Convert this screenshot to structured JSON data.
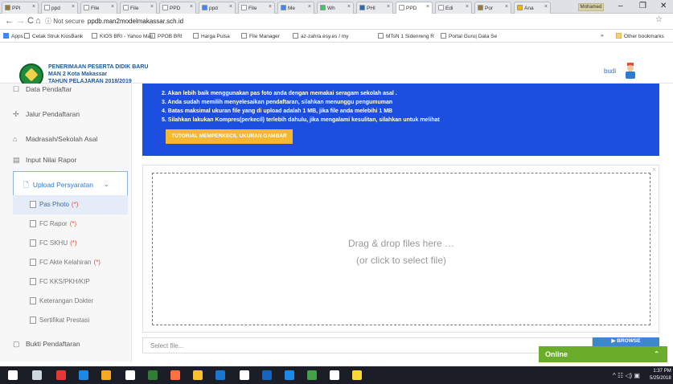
{
  "browser": {
    "tabs": [
      {
        "label": "PPI",
        "fav": "#9c7b2d",
        "active": false
      },
      {
        "label": "ppd",
        "fav": "#ffffff",
        "active": false
      },
      {
        "label": "File",
        "fav": "#ffffff",
        "active": false
      },
      {
        "label": "File",
        "fav": "#ffffff",
        "active": false
      },
      {
        "label": "PPD",
        "fav": "#ffffff",
        "active": false
      },
      {
        "label": "ppd",
        "fav": "#4285f4",
        "active": false
      },
      {
        "label": "File",
        "fav": "#ffffff",
        "active": false
      },
      {
        "label": "Me",
        "fav": "#4285f4",
        "active": false
      },
      {
        "label": "Wh",
        "fav": "#25d366",
        "active": false
      },
      {
        "label": "PHI",
        "fav": "#2b6bb0",
        "active": false
      },
      {
        "label": "PPD",
        "fav": "#ffffff",
        "active": true
      },
      {
        "label": "Edi",
        "fav": "#ffffff",
        "active": false
      },
      {
        "label": "Por",
        "fav": "#9c7b2d",
        "active": false
      },
      {
        "label": "Ana",
        "fav": "#f4b400",
        "active": false
      }
    ],
    "tab_close": "×",
    "profile_name": "Mohamed",
    "window_controls": {
      "minimize": "–",
      "maximize": "❐",
      "close": "✕"
    },
    "nav": {
      "back": "←",
      "forward": "→",
      "reload": "C",
      "home": "⌂"
    },
    "url_security": "ⓘ Not secure",
    "url": "ppdb.man2modelmakassar.sch.id",
    "star": "☆",
    "bookmarks": [
      {
        "label": "Apps"
      },
      {
        "label": "Cetak Struk KiosBank"
      },
      {
        "label": "KIOS BRI - Yahoo Mail"
      },
      {
        "label": "PPOB BRI"
      },
      {
        "label": "Harga Pulsa"
      },
      {
        "label": "File Manager"
      },
      {
        "label": "az-zahra.esy.es / my"
      },
      {
        "label": "MTsN 1 Sidenreng R"
      },
      {
        "label": "Portal Guru| Data Se"
      }
    ],
    "bookmarks_more": "»",
    "other_bookmarks": "Other bookmarks"
  },
  "header": {
    "title_line1": "PENERIMAAN PESERTA DIDIK BARU",
    "title_line2": "MAN 2 Kota Makassar",
    "title_line3": "TAHUN PELAJARAN 2018/2019",
    "user": "budi"
  },
  "sidebar": {
    "items": [
      {
        "label": "Data Pendaftar",
        "icon": "user-icon"
      },
      {
        "label": "Jalur Pendaftaran",
        "icon": "route-icon"
      },
      {
        "label": "Madrasah/Sekolah Asal",
        "icon": "graduation-cap-icon"
      },
      {
        "label": "Input Nilai Rapor",
        "icon": "book-icon"
      }
    ],
    "upload": {
      "label": "Upload Persyaratan",
      "icon": "file-icon",
      "chevron": "⌄"
    },
    "sub_items": [
      {
        "label": "Pas Photo",
        "required": "(*)"
      },
      {
        "label": "FC Rapor",
        "required": "(*)"
      },
      {
        "label": "FC SKHU",
        "required": "(*)"
      },
      {
        "label": "FC Akte Kelahiran",
        "required": "(*)"
      },
      {
        "label": "FC KKS/PKH/KIP",
        "required": ""
      },
      {
        "label": "Keterangan Dokter",
        "required": ""
      },
      {
        "label": "Sertifikat Prestasi",
        "required": ""
      }
    ],
    "bukti": {
      "label": "Bukti Pendaftaran"
    }
  },
  "info": {
    "lines": [
      "2. Akan lebih baik menggunakan pas foto anda dengan memakai seragam sekolah asal .",
      "3. Anda sudah memilih menyelesaikan pendaftaran, silahkan menunggu pengumuman",
      "4. Batas maksimal ukuran file yang di upload adalah 1 MB, jika file anda melebihi 1 MB",
      "5. Silahkan lakukan Kompres(perkecil) terlebih dahulu, jika mengalami kesulitan, silahkan untuk melihat"
    ],
    "tutorial_button": "TUTORIAL MEMPERKECIL UKURAN GAMBAR"
  },
  "dropzone": {
    "line1": "Drag & drop files here …",
    "line2": "(or click to select file)",
    "close": "×"
  },
  "file_input": {
    "placeholder": "Select file...",
    "browse": "BROWSE",
    "browse_icon": "folder-icon"
  },
  "chat": {
    "label": "Online",
    "toggle": "⌃"
  },
  "taskbar": {
    "icons": [
      "windows-start-icon",
      "task-view-icon",
      "opera-icon",
      "edge-icon",
      "file-explorer-icon",
      "store-icon",
      "excel-icon",
      "firefox-icon",
      "chrome-icon",
      "mail-icon",
      "pen-icon",
      "photos-icon",
      "app-icon",
      "app-icon",
      "app-icon",
      "app-icon"
    ],
    "tray": "^ ☷ ◁) ▣",
    "time": "1:37 PM",
    "date": "5/25/2018"
  }
}
